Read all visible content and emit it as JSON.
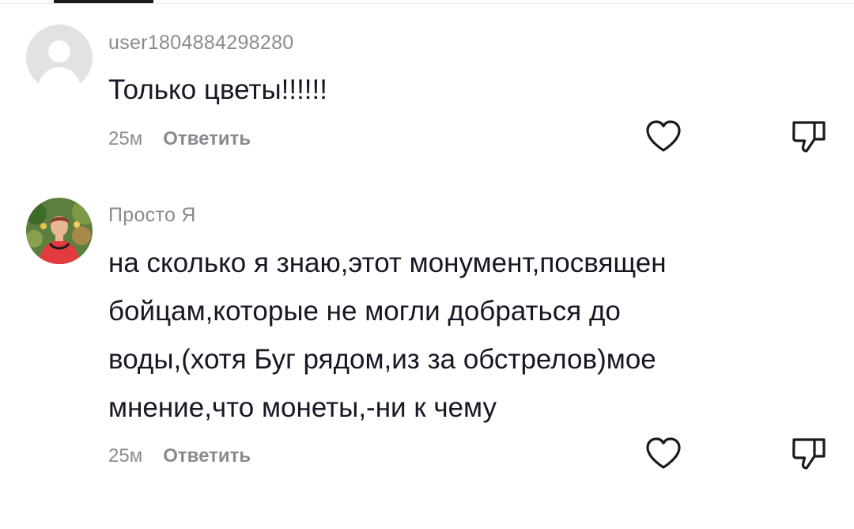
{
  "comments": [
    {
      "username": "user1804884298280",
      "text": "Только цветы!!!!!!",
      "time": "25м",
      "reply_label": "Ответить",
      "avatar": "default-avatar-icon"
    },
    {
      "username": "Просто Я",
      "text_lines": [
        "на сколько я знаю,этот монумент,посвящен",
        "бойцам,которые не могли добраться до",
        "воды,(хотя Буг рядом,из за обстрелов)мое",
        "мнение,что монеты,-ни к чему"
      ],
      "time": "25м",
      "reply_label": "Ответить",
      "avatar": "user-photo-avatar"
    }
  ],
  "icons": {
    "like": "heart-outline-icon",
    "dislike": "thumbs-down-outline-icon"
  },
  "colors": {
    "text": "#161823",
    "muted": "#8a8b91"
  }
}
